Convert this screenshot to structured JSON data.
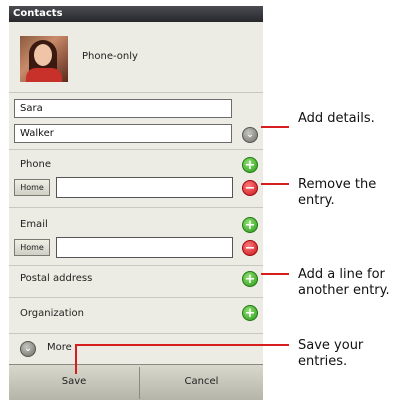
{
  "app": {
    "title": "Contacts"
  },
  "account": {
    "label": "Phone-only"
  },
  "name": {
    "first": "Sara",
    "last": "Walker"
  },
  "sections": {
    "phone": {
      "label": "Phone",
      "type": "Home"
    },
    "email": {
      "label": "Email",
      "type": "Home"
    },
    "postal": {
      "label": "Postal address"
    },
    "organization": {
      "label": "Organization"
    },
    "more": {
      "label": "More"
    }
  },
  "buttons": {
    "save": "Save",
    "cancel": "Cancel"
  },
  "callouts": {
    "add_details": "Add details.",
    "remove_entry": "Remove the entry.",
    "add_line": "Add a line for another entry.",
    "save_entries": "Save your entries."
  },
  "colors": {
    "callout": "#d61e1e",
    "add": "#2a9a1a",
    "remove": "#c8141a"
  },
  "icons": [
    "add-icon",
    "remove-icon",
    "expand-icon"
  ]
}
